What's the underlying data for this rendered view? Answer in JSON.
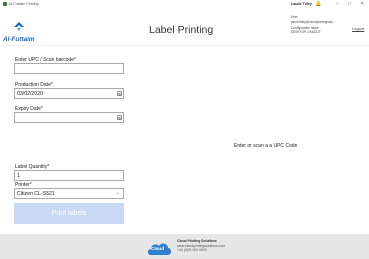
{
  "window": {
    "title": "Al-Futtaim Printing",
    "user_name": "Laude Tilley",
    "minimize": "–",
    "maximize": "□",
    "close": "✕"
  },
  "header": {
    "logo_text": "Al-Futtaim",
    "page_title": "Label Printing",
    "user_label": "User",
    "user_email": "jamie.tilley@cloudprintingsolu",
    "config_label": "Configuration name",
    "config_value": "DESKTOP-GK6321T",
    "logout": "Logout"
  },
  "form": {
    "upc_label": "Enter UPC / Scan barcode*",
    "upc_value": "",
    "production_label": "Production Date*",
    "production_value": "03/02/2020",
    "expiry_label": "Expiry Date*",
    "expiry_value": "",
    "quantity_label": "Label Quantity*",
    "quantity_value": "1",
    "printer_label": "Printer*",
    "printer_value": "Citizen CL-S521",
    "print_button": "Print labels"
  },
  "main": {
    "scan_message": "Enter or scan a a UPC Code"
  },
  "footer": {
    "logo_text": "Cloud",
    "company": "Cloud Printing Solutions",
    "website": "www.cloudprintingsolutions.com",
    "phone": "+44 (0)01 000 0000"
  },
  "colors": {
    "accent": "#1565c0",
    "button_disabled": "#c9d8f5",
    "cloud_blue": "#2f7fd1",
    "footer_bg": "#e6e6e6"
  }
}
